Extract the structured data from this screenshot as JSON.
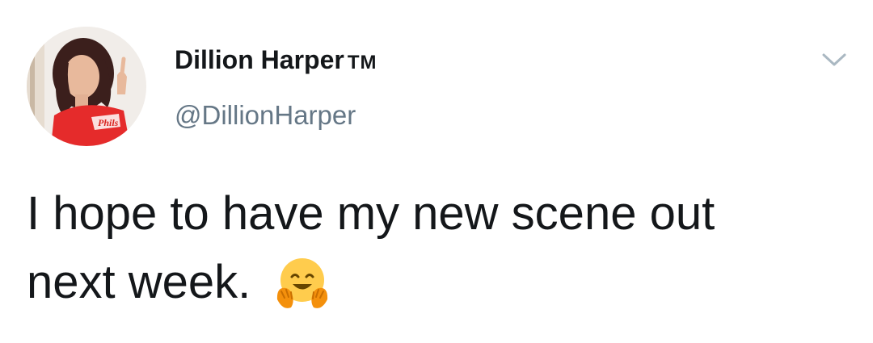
{
  "tweet": {
    "author_name": "Dillion Harper",
    "author_suffix": "TM",
    "author_handle": "@DillionHarper",
    "text_line1": "I hope to have my new scene out",
    "text_line2": "next week."
  },
  "icons": {
    "menu": "chevron-down-icon",
    "emoji": "hugging-face-emoji"
  },
  "colors": {
    "text_primary": "#14171a",
    "text_secondary": "#657786",
    "caret": "#aab8c2"
  }
}
